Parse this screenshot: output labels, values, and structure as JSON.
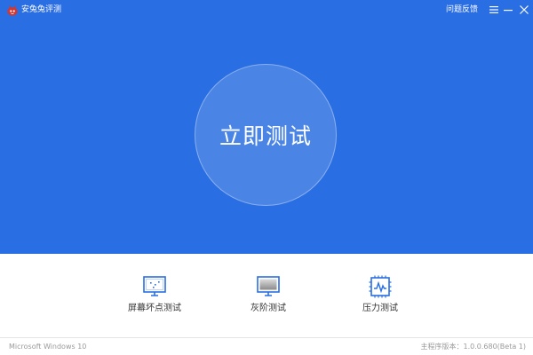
{
  "window": {
    "title": "安兔兔评测",
    "feedback_label": "问题反馈",
    "menu_icon": "hamburger-menu-icon",
    "minimize_icon": "minimize-icon",
    "close_icon": "close-icon"
  },
  "main": {
    "start_button_label": "立即测试"
  },
  "tools": [
    {
      "label": "屏幕坏点测试",
      "icon": "monitor-dots-icon"
    },
    {
      "label": "灰阶测试",
      "icon": "monitor-gradient-icon"
    },
    {
      "label": "压力测试",
      "icon": "chip-pulse-icon"
    }
  ],
  "status": {
    "os": "Microsoft Windows 10",
    "version": "主程序版本：1.0.0.680(Beta 1)"
  },
  "colors": {
    "brand_blue": "#2a6ee3",
    "circle_blue": "#4a85e6",
    "icon_blue": "#2a6ee3",
    "logo_red": "#d9342b"
  }
}
